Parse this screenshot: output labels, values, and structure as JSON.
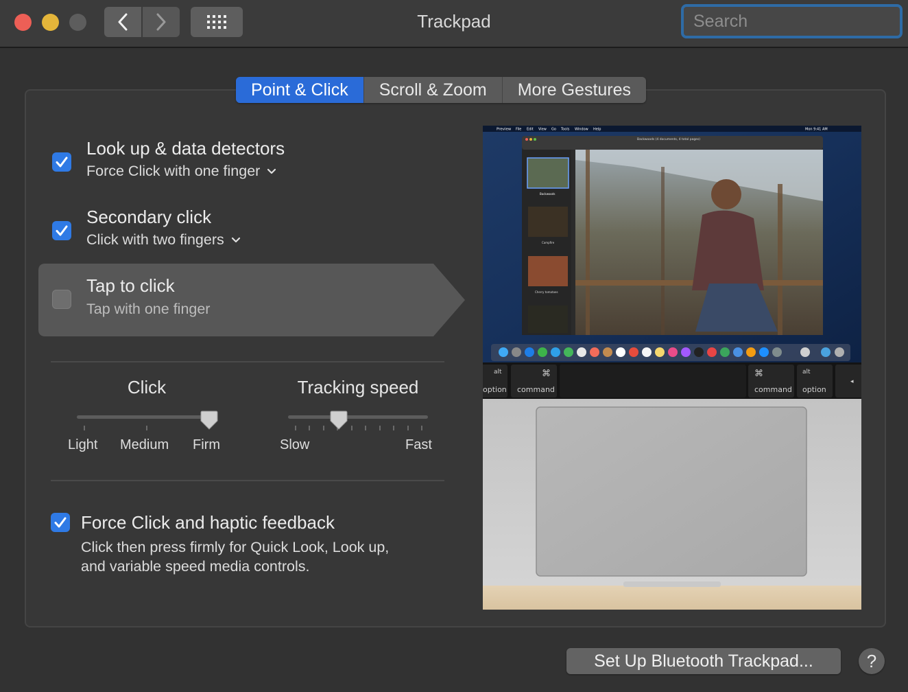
{
  "window": {
    "title": "Trackpad",
    "search_placeholder": "Search",
    "traffic_lights": [
      "close",
      "minimize",
      "zoom"
    ]
  },
  "tabs": [
    {
      "label": "Point & Click",
      "active": true
    },
    {
      "label": "Scroll & Zoom",
      "active": false
    },
    {
      "label": "More Gestures",
      "active": false
    }
  ],
  "options": [
    {
      "title": "Look up & data detectors",
      "subtitle": "Force Click with one finger",
      "checked": true,
      "has_dropdown": true
    },
    {
      "title": "Secondary click",
      "subtitle": "Click with two fingers",
      "checked": true,
      "has_dropdown": true
    },
    {
      "title": "Tap to click",
      "subtitle": "Tap with one finger",
      "checked": false,
      "has_dropdown": false,
      "highlighted": true
    }
  ],
  "click_slider": {
    "label": "Click",
    "ticks": [
      "Light",
      "Medium",
      "Firm"
    ],
    "selected": "Firm"
  },
  "tracking_slider": {
    "label": "Tracking speed",
    "min_label": "Slow",
    "max_label": "Fast",
    "tick_count": 10,
    "value_fraction": 0.35
  },
  "force_click": {
    "title": "Force Click and haptic feedback",
    "description_line1": "Click then press firmly for Quick Look, Look up,",
    "description_line2": "and variable speed media controls.",
    "checked": true
  },
  "preview": {
    "menubar": [
      "Preview",
      "File",
      "Edit",
      "View",
      "Go",
      "Tools",
      "Window",
      "Help"
    ],
    "menubar_time": "Mon 9:41 AM",
    "window_title": "Backwoods (4 documents, 4 total pages)",
    "thumbnails": [
      "Backwoods",
      "Campfire",
      "Cherry tomatoes"
    ],
    "keys": {
      "left_alt": "alt",
      "left_option": "option",
      "left_cmd_symbol": "⌘",
      "left_command": "command",
      "right_cmd_symbol": "⌘",
      "right_command": "command",
      "right_alt": "alt",
      "right_option": "option",
      "arrow": "◂"
    }
  },
  "footer": {
    "setup_button": "Set Up Bluetooth Trackpad...",
    "help_button": "?"
  },
  "colors": {
    "accent": "#2a6bd8",
    "checkbox_on": "#2f7ae5",
    "background": "#323232"
  }
}
